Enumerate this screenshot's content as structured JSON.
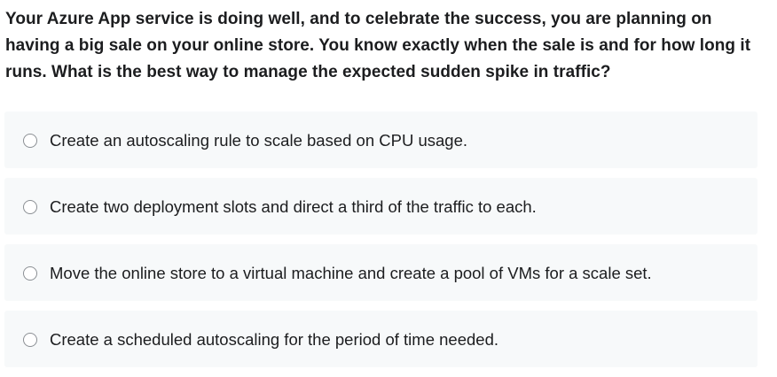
{
  "question": {
    "text": "Your Azure App service is doing well, and to celebrate the success, you are planning on having a big sale on your online store. You know exactly when the sale is and for how long it runs. What is the best way to manage the expected sudden spike in traffic?"
  },
  "options": [
    {
      "label": "Create an autoscaling rule to scale based on CPU usage.",
      "selected": false
    },
    {
      "label": "Create two deployment slots and direct a third of the traffic to each.",
      "selected": false
    },
    {
      "label": "Move the online store to a virtual machine and create a pool of VMs for a scale set.",
      "selected": false
    },
    {
      "label": "Create a scheduled autoscaling for the period of time needed.",
      "selected": false
    }
  ],
  "colors": {
    "option_background": "#f7f9fa",
    "radio_border": "#8b8f94",
    "text": "#1c1d1f"
  }
}
